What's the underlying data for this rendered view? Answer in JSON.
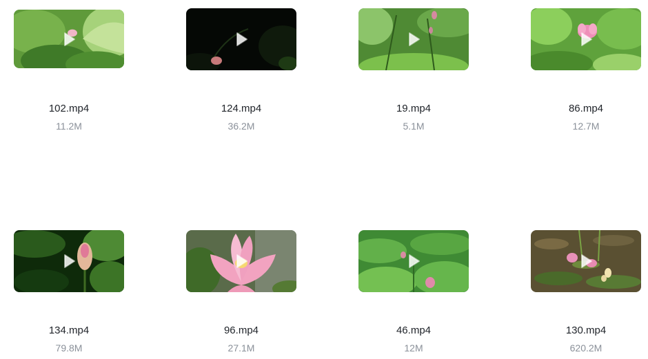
{
  "videos": [
    {
      "name": "102.mp4",
      "size": "11.2M",
      "thumb_icon": "lotus-leaves-video-thumbnail",
      "play_icon": "play-icon"
    },
    {
      "name": "124.mp4",
      "size": "36.2M",
      "thumb_icon": "dark-lotus-bud-video-thumbnail",
      "play_icon": "play-icon"
    },
    {
      "name": "19.mp4",
      "size": "5.1M",
      "thumb_icon": "lotus-stems-video-thumbnail",
      "play_icon": "play-icon"
    },
    {
      "name": "86.mp4",
      "size": "12.7M",
      "thumb_icon": "pink-lotus-video-thumbnail",
      "play_icon": "play-icon"
    },
    {
      "name": "134.mp4",
      "size": "79.8M",
      "thumb_icon": "lotus-bud-video-thumbnail",
      "play_icon": "play-icon"
    },
    {
      "name": "96.mp4",
      "size": "27.1M",
      "thumb_icon": "lotus-flower-closeup-video-thumbnail",
      "play_icon": "play-icon"
    },
    {
      "name": "46.mp4",
      "size": "12M",
      "thumb_icon": "lotus-pond-video-thumbnail",
      "play_icon": "play-icon"
    },
    {
      "name": "130.mp4",
      "size": "620.2M",
      "thumb_icon": "water-lily-pond-video-thumbnail",
      "play_icon": "play-icon"
    }
  ],
  "colors": {
    "name_text": "#1f2329",
    "size_text": "#8a9099",
    "background": "#ffffff"
  }
}
